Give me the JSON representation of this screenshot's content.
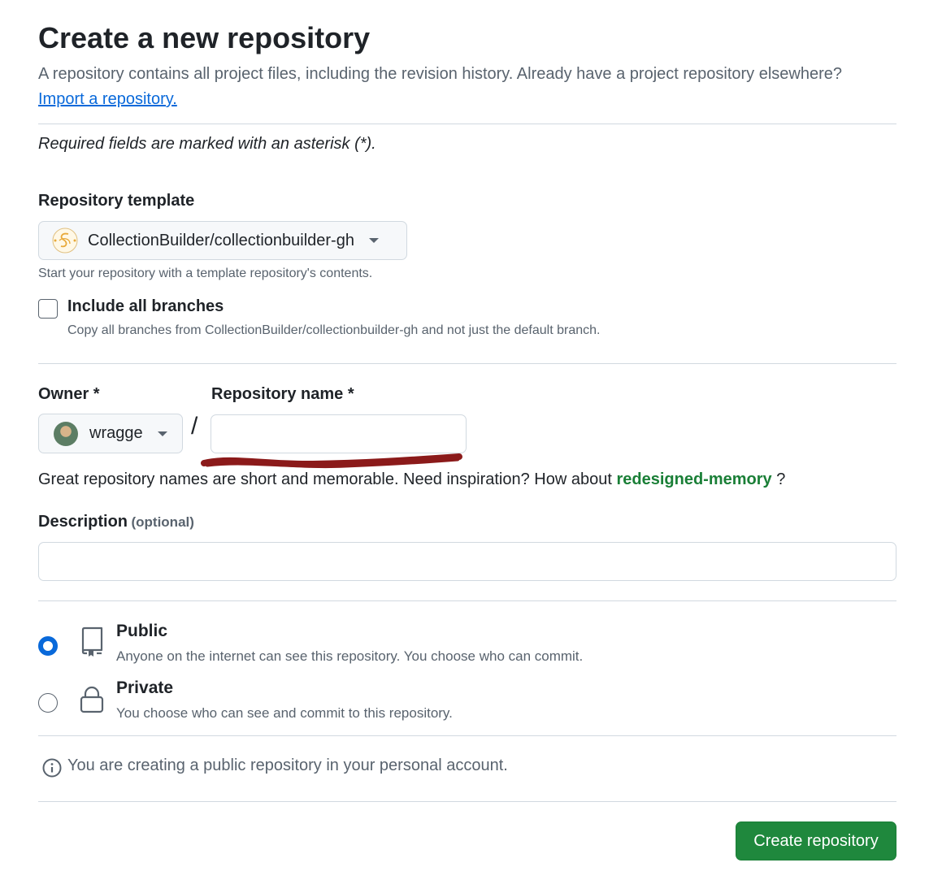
{
  "header": {
    "title": "Create a new repository",
    "intro": "A repository contains all project files, including the revision history. Already have a project repository elsewhere?",
    "import_link": "Import a repository."
  },
  "required_note": "Required fields are marked with an asterisk (*).",
  "template": {
    "label": "Repository template",
    "selected": "CollectionBuilder/collectionbuilder-gh",
    "hint": "Start your repository with a template repository's contents.",
    "include_branches_label": "Include all branches",
    "include_branches_hint": "Copy all branches from CollectionBuilder/collectionbuilder-gh and not just the default branch.",
    "include_branches_checked": false
  },
  "owner": {
    "label": "Owner *",
    "value": "wragge"
  },
  "separator": "/",
  "repo_name": {
    "label": "Repository name *",
    "value": ""
  },
  "name_hint": {
    "prefix": "Great repository names are short and memorable. Need inspiration? How about",
    "suggestion": "redesigned-memory",
    "suffix": "?"
  },
  "description": {
    "label": "Description",
    "optional": "(optional)",
    "value": ""
  },
  "visibility": {
    "options": [
      {
        "title": "Public",
        "desc": "Anyone on the internet can see this repository. You choose who can commit.",
        "icon": "repo-icon",
        "checked": true
      },
      {
        "title": "Private",
        "desc": "You choose who can see and commit to this repository.",
        "icon": "lock-icon",
        "checked": false
      }
    ]
  },
  "info_note": "You are creating a public repository in your personal account.",
  "submit_label": "Create repository",
  "colors": {
    "accent_blue": "#0969da",
    "success_green": "#1f883d",
    "suggestion_green": "#1a7f37",
    "redaction_mark": "#8b1a1a"
  }
}
